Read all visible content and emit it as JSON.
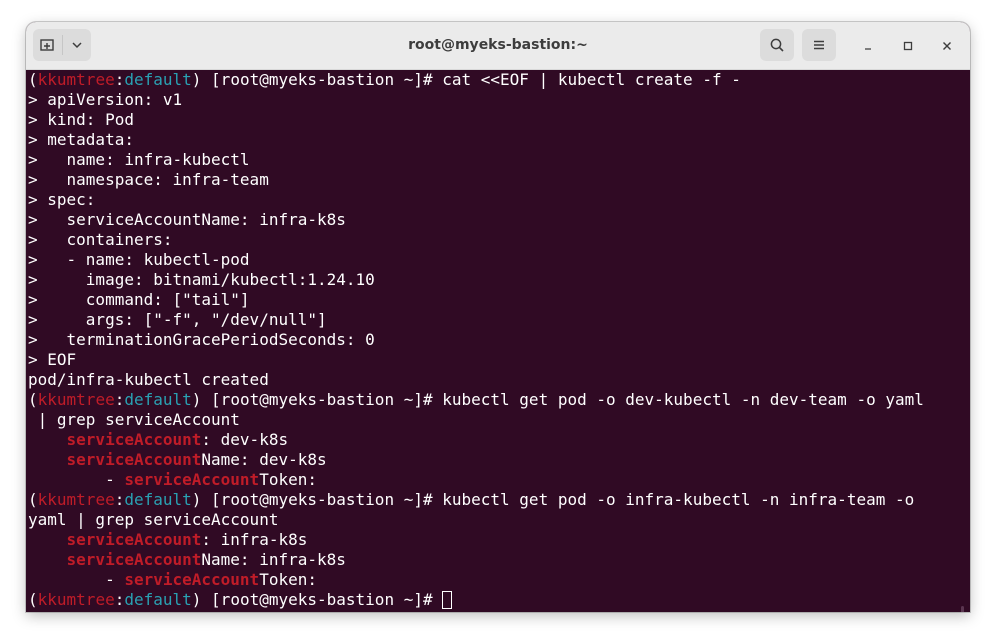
{
  "window": {
    "title": "root@myeks-bastion:~"
  },
  "icons": {
    "new_tab": "new-tab-icon",
    "dropdown": "chevron-down-icon",
    "search": "search-icon",
    "menu": "hamburger-menu-icon",
    "minimize": "minimize-icon",
    "maximize": "maximize-icon",
    "close": "close-icon"
  },
  "colors": {
    "terminal_bg": "#300a24",
    "context": "#c01c28",
    "namespace": "#2aa1b3",
    "grep_match": "#c01c28",
    "titlebar": "#ebebeb"
  },
  "prompt": {
    "open": "(",
    "context": "kkumtree",
    "colon": ":",
    "namespace": "default",
    "rest": ") [root@myeks-bastion ~]# "
  },
  "terminal": {
    "cmd1": "cat <<EOF | kubectl create -f -",
    "heredoc": [
      "> apiVersion: v1",
      "> kind: Pod",
      "> metadata:",
      ">   name: infra-kubectl",
      ">   namespace: infra-team",
      "> spec:",
      ">   serviceAccountName: infra-k8s",
      ">   containers:",
      ">   - name: kubectl-pod",
      ">     image: bitnami/kubectl:1.24.10",
      ">     command: [\"tail\"]",
      ">     args: [\"-f\", \"/dev/null\"]",
      ">   terminationGracePeriodSeconds: 0",
      "> EOF"
    ],
    "created": "pod/infra-kubectl created",
    "cmd2": "kubectl get pod -o dev-kubectl -n dev-team -o yaml",
    "cmd2_wrap": " | grep serviceAccount",
    "cmd3": "kubectl get pod -o infra-kubectl -n infra-team -o",
    "cmd3_wrap": "yaml | grep serviceAccount",
    "match": "serviceAccount",
    "indent4": "    ",
    "indent8": "        - ",
    "dev": {
      "sa_rest": ": dev-k8s",
      "name_rest": "Name: dev-k8s",
      "token_rest": "Token:"
    },
    "infra": {
      "sa_rest": ": infra-k8s",
      "name_rest": "Name: infra-k8s",
      "token_rest": "Token:"
    }
  }
}
